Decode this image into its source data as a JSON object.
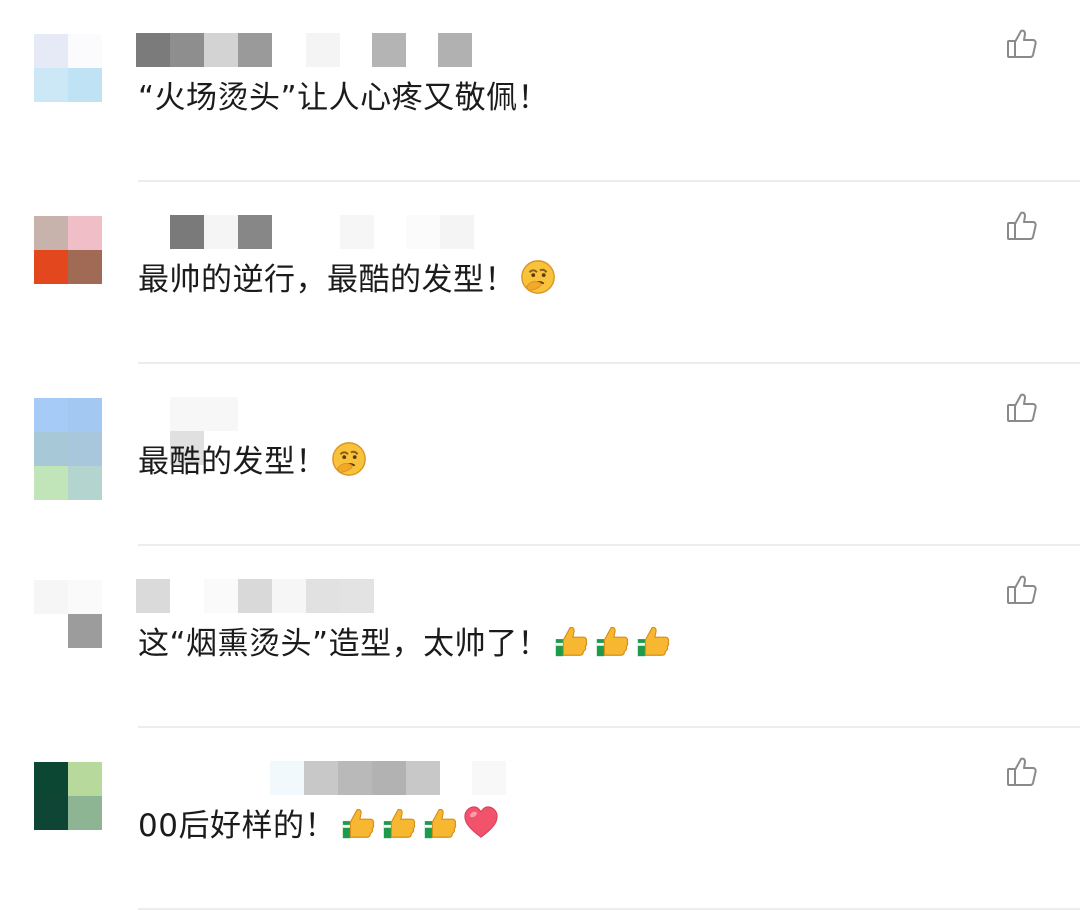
{
  "comments": [
    {
      "text": "“火场烫头”让人心疼又敬佩！",
      "avatar_colors": [
        "#e6eaf6",
        "#fbfbfd",
        "#cce7f6",
        "#bfe3f4"
      ],
      "username_blocks": [
        "#7b7b7b",
        "#8e8e8e",
        "#d3d3d3",
        "#9a9a9a",
        "#f4f4f4",
        "#b4b4b4",
        "#b1b1b1"
      ],
      "emojis": []
    },
    {
      "text": "最帅的逆行，最酷的发型！",
      "avatar_colors": [
        "#c7b3ab",
        "#efbec7",
        "#e2471d",
        "#a16a55"
      ],
      "username_blocks": [
        "#ffffff",
        "#7a7a7a",
        "#f5f5f5",
        "#878787",
        "#ffffff",
        "#f6f6f6",
        "#fbfbfb",
        "#f4f4f4"
      ],
      "emojis": [
        "thinking-face"
      ]
    },
    {
      "text": "最酷的发型！",
      "avatar_colors": [
        "#a6cbf6",
        "#a3c9f3",
        "#a7c8d6",
        "#a9c7dc",
        "#c1e5b8",
        "#b3d4cf"
      ],
      "username_blocks": [
        "#f7f7f7",
        "#e0e0e0"
      ],
      "emojis": [
        "thinking-face"
      ]
    },
    {
      "text": "这“烟熏烫头”造型，太帅了！",
      "avatar_colors": [
        "#f6f6f6",
        "#fafafa",
        "#ffffff",
        "#9c9c9c"
      ],
      "username_blocks": [
        "#dadada",
        "#fafafa",
        "#d9d9d9",
        "#f6f6f6",
        "#e1e1e1",
        "#e3e3e3"
      ],
      "emojis": [
        "thumbs-up",
        "thumbs-up",
        "thumbs-up"
      ]
    },
    {
      "text": "00后好样的！",
      "avatar_colors": [
        "#0b4733",
        "#b8d99c",
        "#0e4535",
        "#8db593"
      ],
      "username_blocks": [
        "#f2f9fc",
        "#c8c8c8",
        "#b9b9b9",
        "#b2b2b2",
        "#c8c8c8",
        "#f8f8f8"
      ],
      "emojis": [
        "thumbs-up",
        "thumbs-up",
        "thumbs-up",
        "red-heart"
      ]
    }
  ],
  "like_icon": "thumbs-up-outline-icon",
  "colors": {
    "text": "#1b1b1b",
    "divider": "#ededed",
    "icon": "#8a8a8a"
  }
}
